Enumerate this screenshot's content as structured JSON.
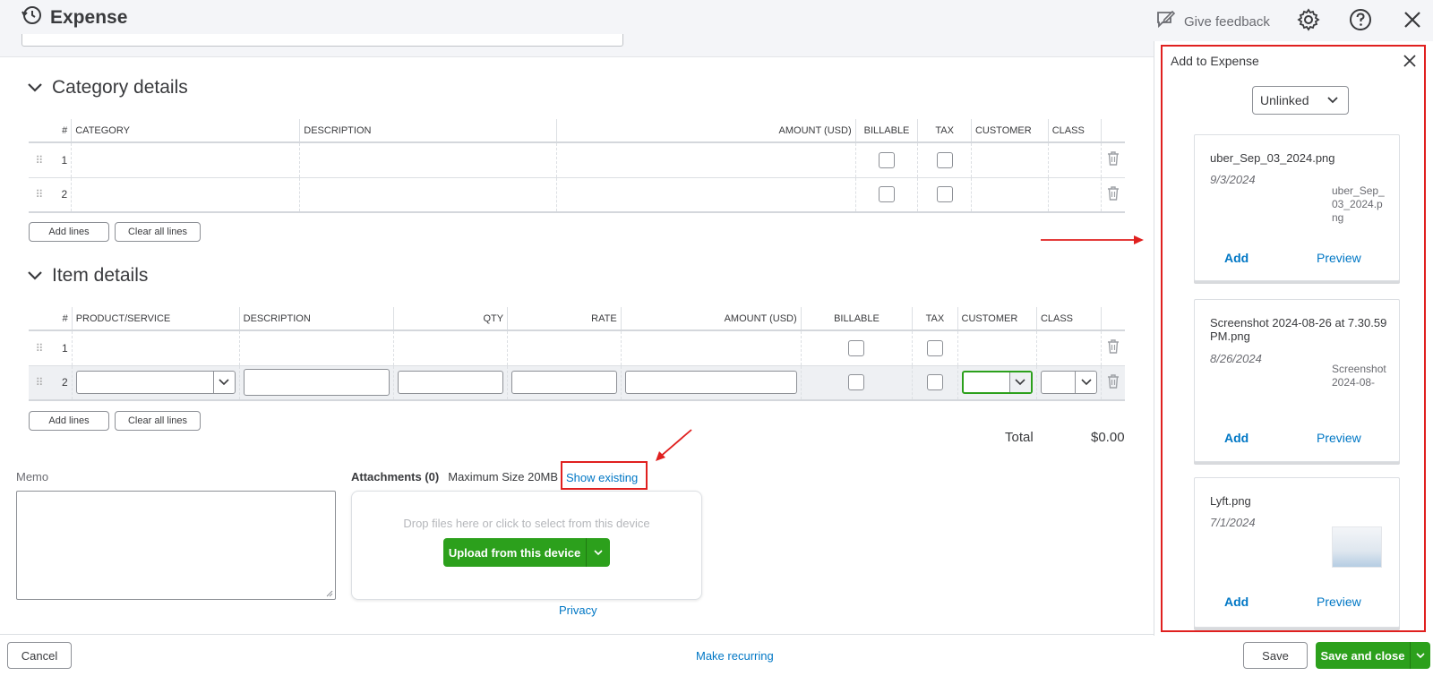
{
  "header": {
    "title": "Expense",
    "feedback_label": "Give feedback"
  },
  "category_section": {
    "title": "Category details",
    "columns": [
      "#",
      "CATEGORY",
      "DESCRIPTION",
      "AMOUNT (USD)",
      "BILLABLE",
      "TAX",
      "CUSTOMER",
      "CLASS"
    ],
    "rows": [
      {
        "num": "1"
      },
      {
        "num": "2"
      }
    ],
    "add_lines": "Add lines",
    "clear_lines": "Clear all lines"
  },
  "item_section": {
    "title": "Item details",
    "columns": [
      "#",
      "PRODUCT/SERVICE",
      "DESCRIPTION",
      "QTY",
      "RATE",
      "AMOUNT (USD)",
      "BILLABLE",
      "TAX",
      "CUSTOMER",
      "CLASS"
    ],
    "rows": [
      {
        "num": "1"
      },
      {
        "num": "2"
      }
    ],
    "add_lines": "Add lines",
    "clear_lines": "Clear all lines"
  },
  "total": {
    "label": "Total",
    "value": "$0.00"
  },
  "memo": {
    "label": "Memo"
  },
  "attachments": {
    "title": "Attachments (0)",
    "max_size": "Maximum Size 20MB",
    "show_existing": "Show existing",
    "drop_text": "Drop files here or click to select from this device",
    "upload_label": "Upload from this device",
    "privacy": "Privacy"
  },
  "footer": {
    "cancel": "Cancel",
    "make_recurring": "Make recurring",
    "save": "Save",
    "save_close": "Save and close"
  },
  "panel": {
    "title": "Add to Expense",
    "filter_value": "Unlinked",
    "cards": [
      {
        "name": "uber_Sep_03_2024.png",
        "date": "9/3/2024",
        "thumb_alt": "uber_Sep_03_2024.png",
        "add": "Add",
        "preview": "Preview"
      },
      {
        "name": "Screenshot 2024-08-26 at 7.30.59 PM.png",
        "date": "8/26/2024",
        "thumb_alt": "Screenshot 2024-08-",
        "add": "Add",
        "preview": "Preview"
      },
      {
        "name": "Lyft.png",
        "date": "7/1/2024",
        "thumb_alt": "",
        "add": "Add",
        "preview": "Preview"
      }
    ]
  },
  "colors": {
    "accent_green": "#2ca01c",
    "link_blue": "#0077c5",
    "annotation_red": "#e0201f"
  }
}
